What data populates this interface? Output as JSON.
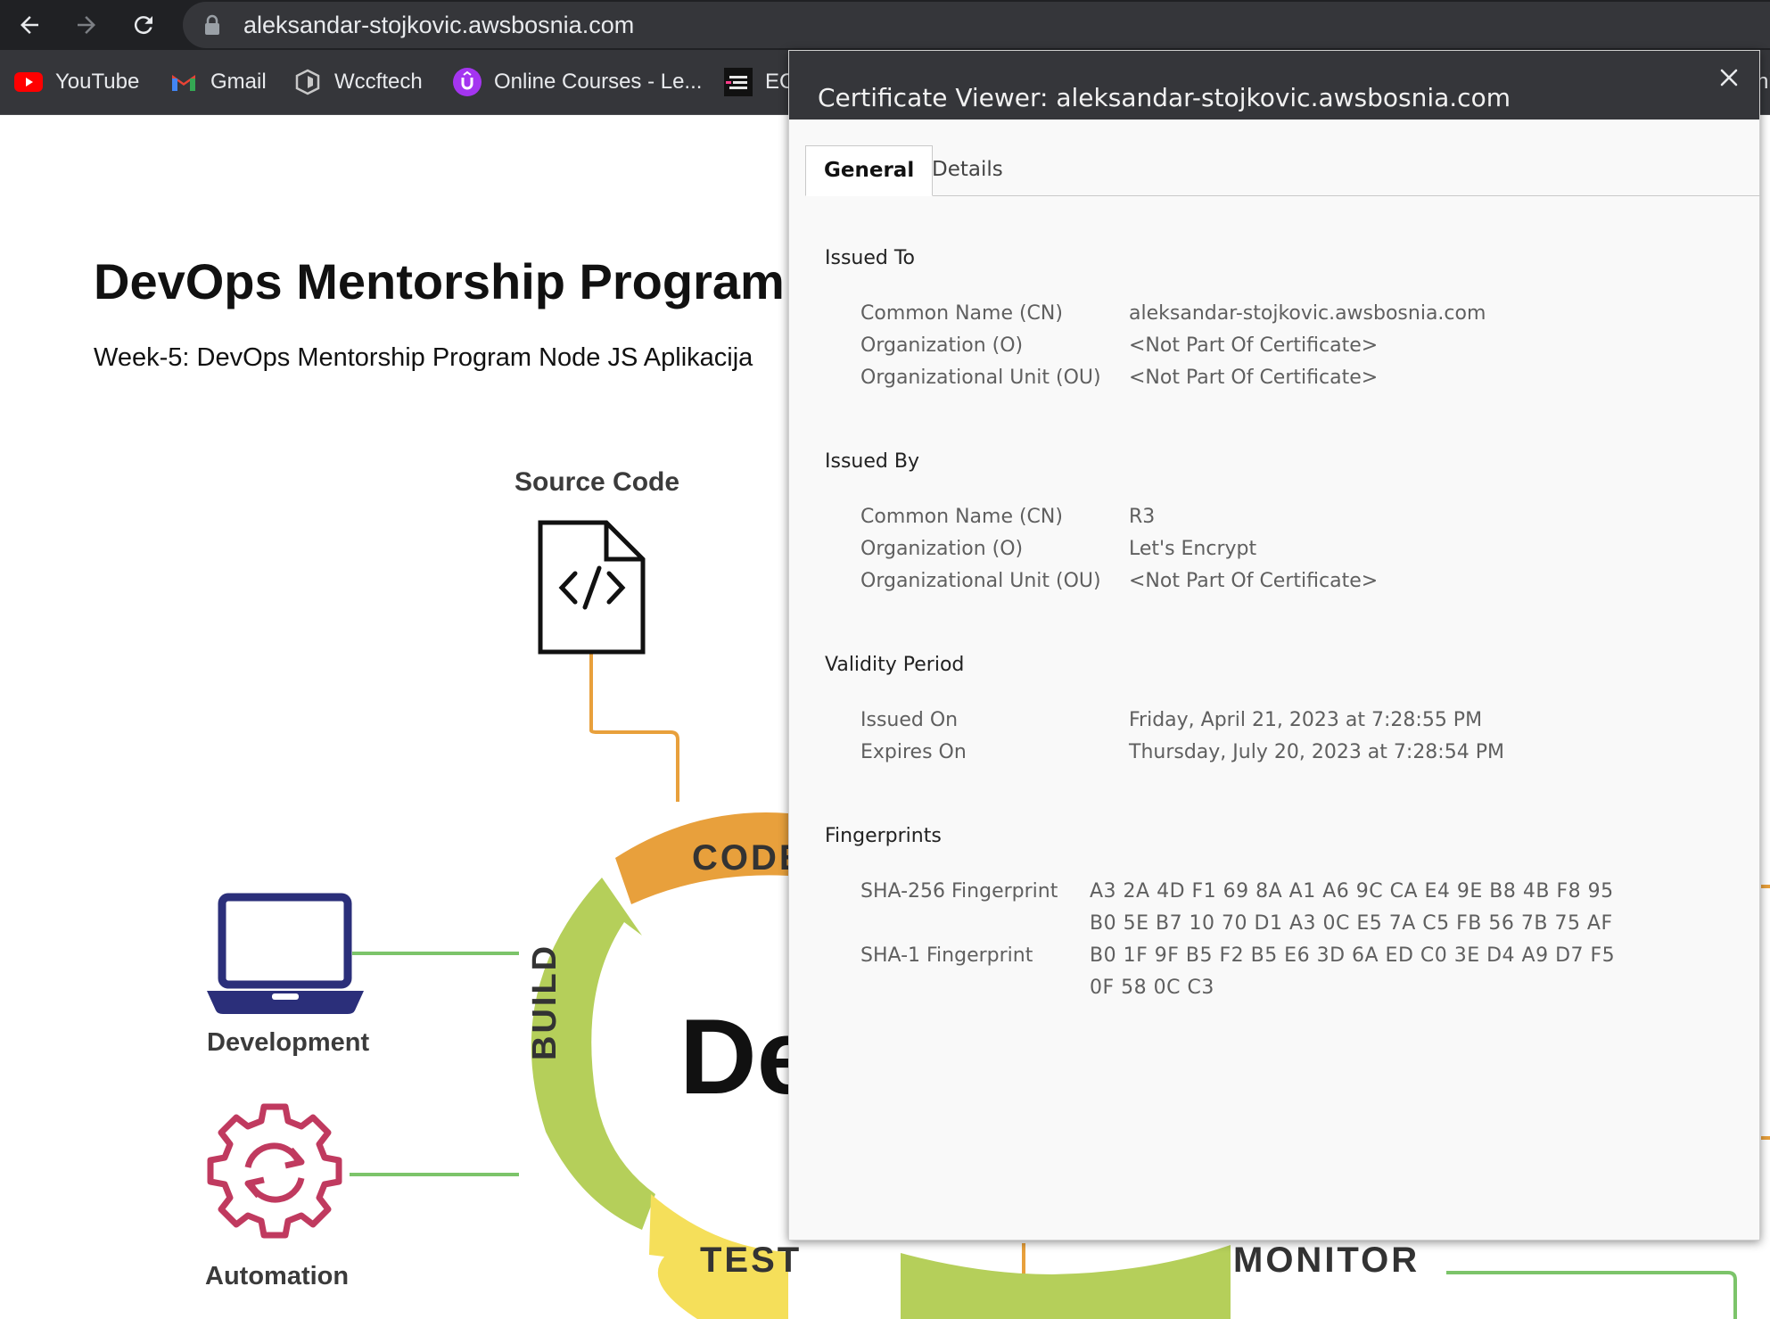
{
  "browser": {
    "url": "aleksandar-stojkovic.awsbosnia.com",
    "bookmarks": [
      {
        "label": "YouTube",
        "icon": "youtube-icon"
      },
      {
        "label": "Gmail",
        "icon": "gmail-icon"
      },
      {
        "label": "Wccftech",
        "icon": "wccftech-icon"
      },
      {
        "label": "Online Courses - Le...",
        "icon": "udemy-icon"
      },
      {
        "label": "EC",
        "icon": "ec-icon"
      }
    ],
    "bookmark_overflow": "hi"
  },
  "page": {
    "title": "DevOps Mentorship Program",
    "subtitle": "Week-5: DevOps Mentorship Program Node JS Aplikacija",
    "diagram": {
      "source_code_label": "Source Code",
      "development_label": "Development",
      "automation_label": "Automation",
      "segments": {
        "code": "CODE",
        "build": "BUILD",
        "test": "TEST",
        "monitor": "MONITOR"
      },
      "center_text": "De",
      "colors": {
        "orange": "#e8a03c",
        "green": "#b5cf5a",
        "yellow": "#f5df5a",
        "laptop": "#2b2f7a",
        "gear": "#c03a5f",
        "line_green": "#7cc46a",
        "line_orange": "#e8a03c"
      }
    }
  },
  "dialog": {
    "title": "Certificate Viewer: aleksandar-stojkovic.awsbosnia.com",
    "tabs": {
      "general": "General",
      "details": "Details"
    },
    "issued_to": {
      "heading": "Issued To",
      "rows": [
        {
          "label": "Common Name (CN)",
          "value": "aleksandar-stojkovic.awsbosnia.com"
        },
        {
          "label": "Organization (O)",
          "value": "<Not Part Of Certificate>"
        },
        {
          "label": "Organizational Unit (OU)",
          "value": "<Not Part Of Certificate>"
        }
      ]
    },
    "issued_by": {
      "heading": "Issued By",
      "rows": [
        {
          "label": "Common Name (CN)",
          "value": "R3"
        },
        {
          "label": "Organization (O)",
          "value": "Let's Encrypt"
        },
        {
          "label": "Organizational Unit (OU)",
          "value": "<Not Part Of Certificate>"
        }
      ]
    },
    "validity": {
      "heading": "Validity Period",
      "rows": [
        {
          "label": "Issued On",
          "value": "Friday, April 21, 2023 at 7:28:55 PM"
        },
        {
          "label": "Expires On",
          "value": "Thursday, July 20, 2023 at 7:28:54 PM"
        }
      ]
    },
    "fingerprints": {
      "heading": "Fingerprints",
      "sha256_label": "SHA-256 Fingerprint",
      "sha256_line1": "A3 2A 4D F1 69 8A A1 A6 9C CA E4 9E B8 4B F8 95",
      "sha256_line2": "B0 5E B7 10 70 D1 A3 0C E5 7A C5 FB 56 7B 75 AF",
      "sha1_label": "SHA-1 Fingerprint",
      "sha1_line1": "B0 1F 9F B5 F2 B5 E6 3D 6A ED C0 3E D4 A9 D7 F5",
      "sha1_line2": "0F 58 0C C3"
    }
  }
}
